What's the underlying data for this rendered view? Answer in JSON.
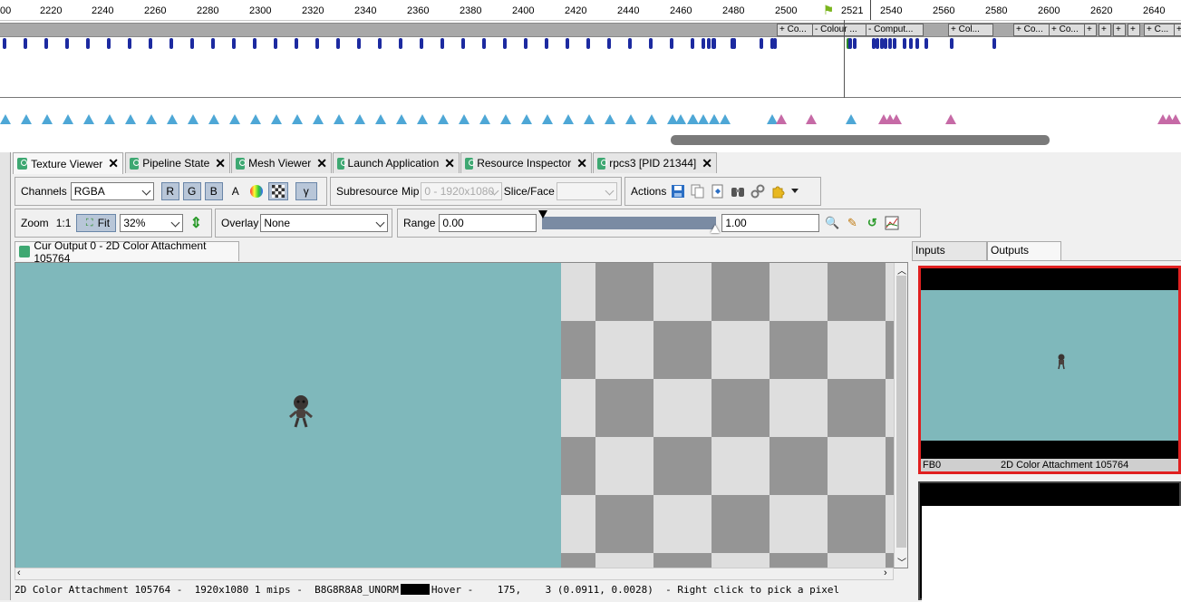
{
  "timeline": {
    "ruler_ticks": [
      "00",
      "2220",
      "2240",
      "2260",
      "2280",
      "2300",
      "2320",
      "2340",
      "2360",
      "2380",
      "2400",
      "2420",
      "2440",
      "2460",
      "2480",
      "2500",
      "2521",
      "2540",
      "2560",
      "2580",
      "2600",
      "2620",
      "2640"
    ],
    "current_event": "2521",
    "markers": [
      "+ Co...",
      "- Colour ...",
      "- Comput...",
      "+ Col...",
      "+ Co...",
      "+ Co...",
      "+",
      "+",
      "+",
      "+",
      "+ C...",
      "+"
    ]
  },
  "tabs": [
    {
      "label": "Texture Viewer",
      "close": "✕"
    },
    {
      "label": "Pipeline State",
      "close": "✕"
    },
    {
      "label": "Mesh Viewer",
      "close": "✕"
    },
    {
      "label": "Launch Application",
      "close": "✕"
    },
    {
      "label": "Resource Inspector",
      "close": "✕"
    },
    {
      "label": "rpcs3 [PID 21344]",
      "close": "✕"
    }
  ],
  "toolbar": {
    "channels_label": "Channels",
    "channels_value": "RGBA",
    "r": "R",
    "g": "G",
    "b": "B",
    "a": "A",
    "gamma": "γ",
    "subresource_label": "Subresource",
    "mip_label": "Mip",
    "mip_value": "0 - 1920x1080",
    "slice_label": "Slice/Face",
    "slice_value": "",
    "actions_label": "Actions",
    "zoom_label": "Zoom",
    "zoom_1to1": "1:1",
    "fit_label": "Fit",
    "zoom_value": "32%",
    "overlay_label": "Overlay",
    "overlay_value": "None",
    "range_label": "Range",
    "range_min": "0.00",
    "range_max": "1.00"
  },
  "viewer": {
    "tab_label": "Cur Output 0 - 2D Color Attachment 105764"
  },
  "status": {
    "left": "2D Color Attachment 105764 -  1920x1080 1 mips -  B8G8R8A8_UNORM",
    "right": "Hover -    175,    3 (0.0911, 0.0028)  - Right click to pick a pixel"
  },
  "right_panel": {
    "tab_inputs": "Inputs",
    "tab_outputs": "Outputs",
    "thumb_slot": "FB0",
    "thumb_name": "2D Color Attachment 105764"
  },
  "colors": {
    "texture_bg": "#7fb8bb",
    "selected_border": "#e02020",
    "event_marker": "#1c2aa0",
    "drawcall_triangle": "#4ea7d6",
    "marker_triangle": "#c66aa6"
  }
}
